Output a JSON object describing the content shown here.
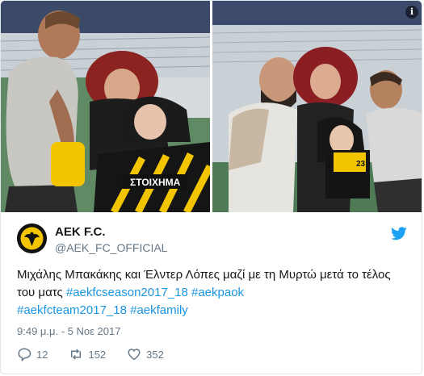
{
  "media": {
    "left_photo_alt": "",
    "right_photo_alt": "",
    "info_badge": "i"
  },
  "account": {
    "display_name": "AEK F.C.",
    "screen_name": "@AEK_FC_OFFICIAL"
  },
  "tweet": {
    "text_main": "Μιχάλης Μπακάκης και Έλντερ Λόπες μαζί με τη Μυρτώ μετά το τέλος του ματς ",
    "hashtags": [
      "#aekfcseason2017_18",
      "#aekpaok",
      "#aekfcteam2017_18",
      "#aekfamily"
    ],
    "timestamp": "9:49 μ.μ. - 5 Νοε 2017"
  },
  "stats": {
    "replies": "12",
    "retweets": "152",
    "likes": "352"
  },
  "colors": {
    "hashtag": "#1b95e0",
    "secondary_text": "#657786",
    "twitter_blue": "#1da1f2",
    "jersey_yellow": "#f2c500"
  },
  "icons": {
    "reply": "reply-icon",
    "retweet": "retweet-icon",
    "like": "heart-icon",
    "brand": "twitter-bird-icon",
    "info": "info-icon"
  }
}
